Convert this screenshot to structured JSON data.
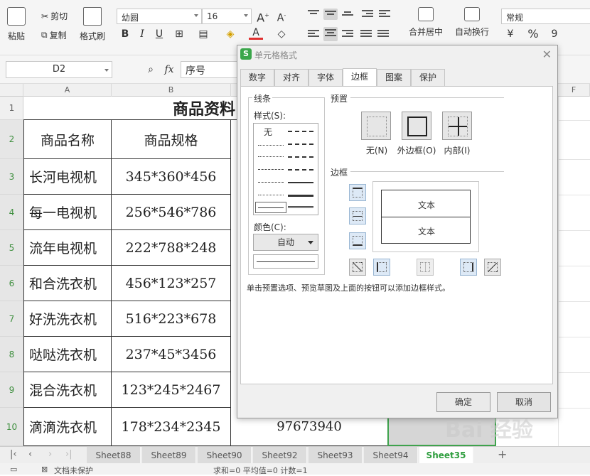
{
  "toolbar": {
    "paste": "粘贴",
    "cut": "剪切",
    "copy": "复制",
    "format_painter": "格式刷",
    "font_name": "幼圆",
    "font_size": "16",
    "merge_center": "合并居中",
    "wrap_text": "自动换行",
    "number_format": "常规",
    "percent": "%",
    "comma": "9"
  },
  "formula_bar": {
    "name_box": "D2",
    "fx": "fx",
    "value": "序号"
  },
  "columns": [
    "A",
    "B",
    "F"
  ],
  "rows": [
    {
      "num": "1",
      "a": "",
      "b": ""
    },
    {
      "num": "2",
      "a": "商品名称",
      "b": "商品规格"
    },
    {
      "num": "3",
      "a": "长河电视机",
      "b": "345*360*456"
    },
    {
      "num": "4",
      "a": "每一电视机",
      "b": "256*546*786"
    },
    {
      "num": "5",
      "a": "流年电视机",
      "b": "222*788*248"
    },
    {
      "num": "6",
      "a": "和合洗衣机",
      "b": "456*123*257"
    },
    {
      "num": "7",
      "a": "好洗洗衣机",
      "b": "516*223*678"
    },
    {
      "num": "8",
      "a": "哒哒洗衣机",
      "b": "237*45*3456"
    },
    {
      "num": "9",
      "a": "混合洗衣机",
      "b": "123*245*2467"
    },
    {
      "num": "10",
      "a": "滴滴洗衣机",
      "b": "178*234*2345"
    }
  ],
  "title_cell": "商品资料",
  "row10_d": "97673940",
  "sheet_tabs": [
    "Sheet88",
    "Sheet89",
    "Sheet90",
    "Sheet92",
    "Sheet93",
    "Sheet94",
    "Sheet35"
  ],
  "active_sheet": "Sheet35",
  "status": {
    "protect": "文档未保护",
    "stats": "求和=0  平均值=0  计数=1"
  },
  "dialog": {
    "title": "单元格格式",
    "tabs": [
      "数字",
      "对齐",
      "字体",
      "边框",
      "图案",
      "保护"
    ],
    "active_tab": "边框",
    "line_group": "线条",
    "style_label": "样式(S):",
    "style_none": "无",
    "color_label": "颜色(C):",
    "color_value": "自动",
    "preset_group": "预置",
    "preset_none": "无(N)",
    "preset_outline": "外边框(O)",
    "preset_inside": "内部(I)",
    "border_group": "边框",
    "preview_text_1": "文本",
    "preview_text_2": "文本",
    "hint": "单击预置选项、预览草图及上面的按钮可以添加边框样式。",
    "ok": "确定",
    "cancel": "取消"
  },
  "watermark": "Bai 经验"
}
